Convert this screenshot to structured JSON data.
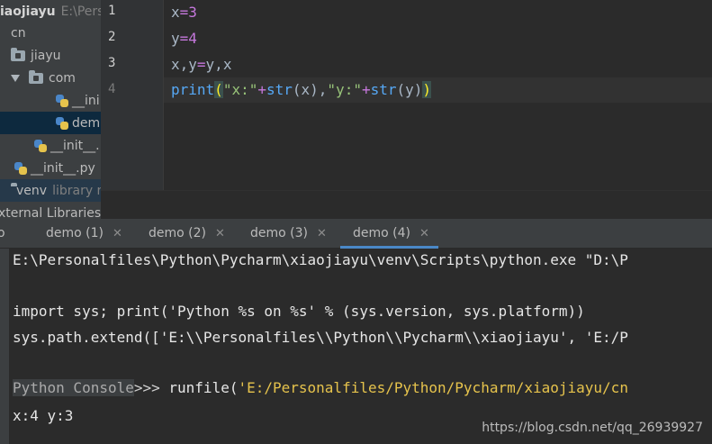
{
  "project_tree": {
    "root_name": "iaojiayu",
    "root_path": "E:\\Pers",
    "items": [
      {
        "label": "cn"
      },
      {
        "label": "jiayu"
      },
      {
        "label": "com"
      },
      {
        "label": "__ini"
      },
      {
        "label": "dem"
      },
      {
        "label": "__init__."
      },
      {
        "label": "__init__.py"
      },
      {
        "label": "venv",
        "hint": "library ro"
      },
      {
        "label": "xternal Libraries"
      }
    ]
  },
  "editor": {
    "line_numbers": [
      "1",
      "2",
      "3",
      "4"
    ],
    "lines": [
      {
        "t1": "x",
        "t2": "=",
        "t3": "3"
      },
      {
        "t1": "y",
        "t2": "=",
        "t3": "4"
      },
      {
        "t1": "x,y",
        "t2": "=",
        "t3": "y,x"
      },
      {
        "fn": "print",
        "p1": "(",
        "s1": "\"x:\"",
        "op1": "+",
        "fn2": "str",
        "mid": "(x),",
        "s2": "\"y:\"",
        "op2": "+",
        "fn3": "str",
        "end": "(y)",
        "p2": ")"
      }
    ]
  },
  "tabs": [
    {
      "label": "o"
    },
    {
      "label": "demo (1)"
    },
    {
      "label": "demo (2)"
    },
    {
      "label": "demo (3)"
    },
    {
      "label": "demo (4)"
    }
  ],
  "tab_close": "✕",
  "console": {
    "line1": "E:\\Personalfiles\\Python\\Pycharm\\xiaojiayu\\venv\\Scripts\\python.exe \"D:\\P",
    "line2": "import sys; print('Python %s on %s' % (sys.version, sys.platform))",
    "line3": "sys.path.extend(['E:\\\\Personalfiles\\\\Python\\\\Pycharm\\\\xiaojiayu', 'E:/P",
    "prompt_label": "Python Console",
    "prompt_arrows": ">>>",
    "cmd_fn": " runfile(",
    "cmd_str": "'E:/Personalfiles/Python/Pycharm/xiaojiayu/cn",
    "output": "x:4 y:3"
  },
  "watermark": "https://blog.csdn.net/qq_26939927"
}
